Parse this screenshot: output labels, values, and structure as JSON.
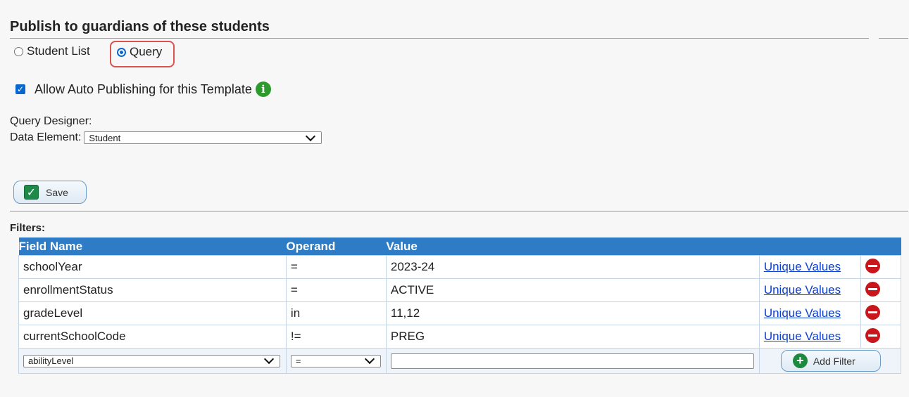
{
  "section": {
    "title": "Publish to guardians of these students"
  },
  "publish_mode": {
    "options": [
      {
        "label": "Student List",
        "selected": false
      },
      {
        "label": "Query",
        "selected": true
      }
    ]
  },
  "auto_publish": {
    "label": "Allow Auto Publishing for this Template",
    "checked": true,
    "info_icon": "info-icon"
  },
  "query_designer": {
    "label": "Query Designer:",
    "data_element_label": "Data Element:",
    "data_element_value": "Student"
  },
  "save_button": {
    "label": "Save"
  },
  "filters": {
    "label": "Filters:",
    "columns": [
      "Field Name",
      "Operand",
      "Value"
    ],
    "rows": [
      {
        "field": "schoolYear",
        "operand": "=",
        "value": "2023-24",
        "link": "Unique Values"
      },
      {
        "field": "enrollmentStatus",
        "operand": "=",
        "value": "ACTIVE",
        "link": "Unique Values"
      },
      {
        "field": "gradeLevel",
        "operand": "in",
        "value": "11,12",
        "link": "Unique Values"
      },
      {
        "field": "currentSchoolCode",
        "operand": "!=",
        "value": "PREG",
        "link": "Unique Values"
      }
    ],
    "new_filter": {
      "field": "abilityLevel",
      "operand": "=",
      "value": "",
      "add_label": "Add Filter"
    }
  },
  "colors": {
    "header_blue": "#2e7bc6",
    "highlight": "#d9534f",
    "remove_red": "#c9161d",
    "add_green": "#1b8a3e"
  }
}
